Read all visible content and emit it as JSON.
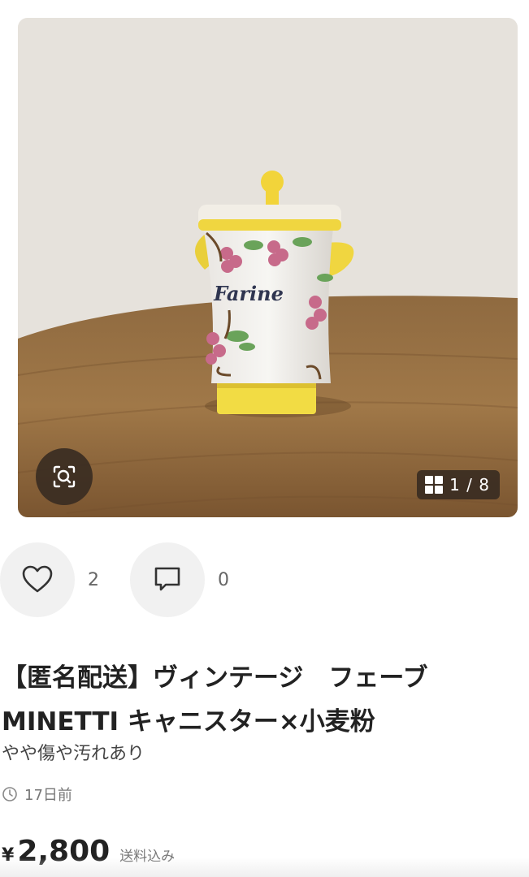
{
  "gallery": {
    "counter_text": "1 / 8",
    "jar_label": "Farine"
  },
  "actions": {
    "like_count": "2",
    "comment_count": "0"
  },
  "item": {
    "title_line1": "【匿名配送】ヴィンテージ　フェーブ",
    "title_line2": "MINETTI キャニスター×小麦粉",
    "condition": "やや傷や汚れあり",
    "posted": "17日前"
  },
  "price": {
    "currency": "¥",
    "amount": "2,800",
    "shipping_note": "送料込み"
  },
  "colors": {
    "overlay_bg": "#3a2c22",
    "circle_bg": "#f1f1f1",
    "text_primary": "#222222",
    "text_secondary": "#777777"
  },
  "icons": {
    "zoom": "scan-search-icon",
    "grid": "grid-icon",
    "like": "heart-icon",
    "comment": "comment-icon",
    "clock": "clock-icon"
  }
}
